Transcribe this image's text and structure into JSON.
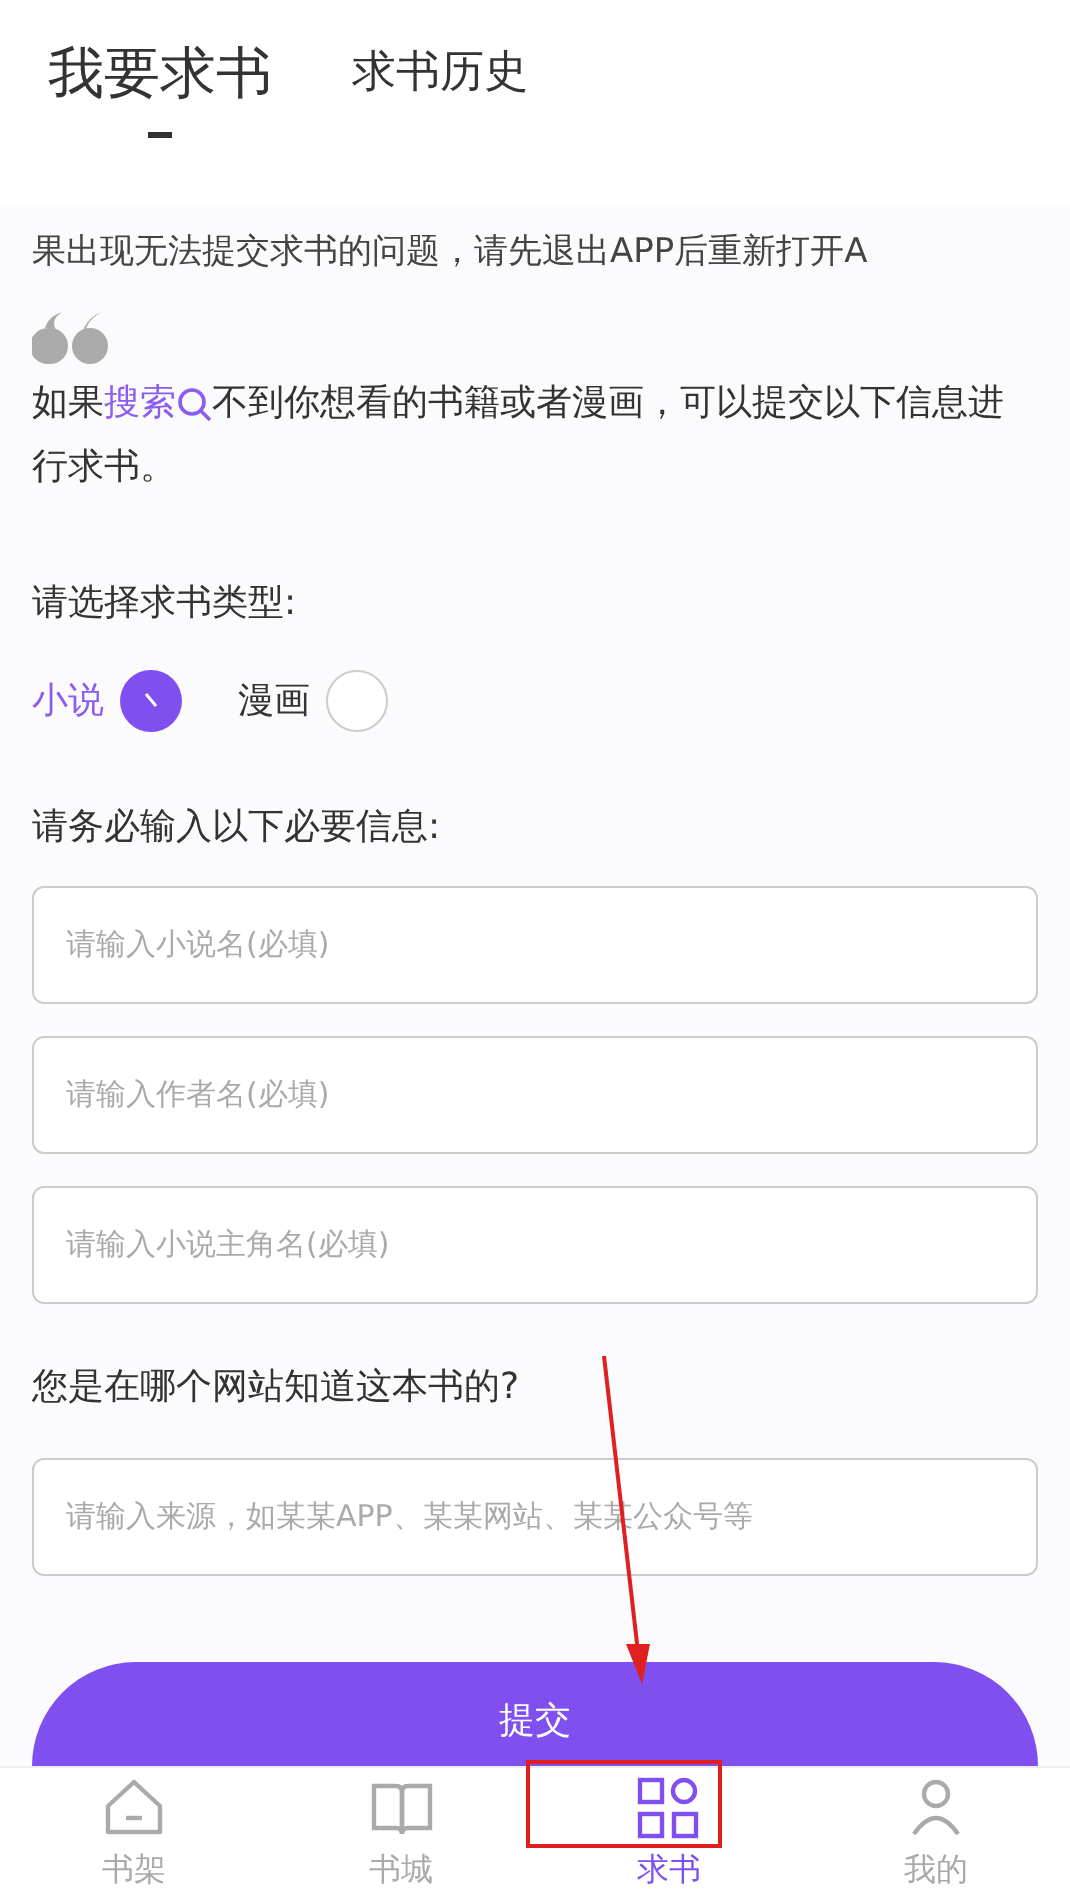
{
  "tabs": [
    {
      "label": "我要求书",
      "selected": true
    },
    {
      "label": "求书历史",
      "selected": false
    }
  ],
  "notice": "果出现无法提交求书的问题，请先退出APP后重新打开A",
  "intro": {
    "before": "如果",
    "link": "搜索",
    "after": "不到你想看的书籍或者漫画，可以提交以下信息进行求书。"
  },
  "type_label": "请选择求书类型:",
  "types": [
    {
      "label": "小说",
      "selected": true
    },
    {
      "label": "漫画",
      "selected": false
    }
  ],
  "required_label": "请务必输入以下必要信息:",
  "fields": [
    {
      "placeholder": "请输入小说名(必填)"
    },
    {
      "placeholder": "请输入作者名(必填)"
    },
    {
      "placeholder": "请输入小说主角名(必填)"
    }
  ],
  "source_label": "您是在哪个网站知道这本书的?",
  "source_field": {
    "placeholder": "请输入来源，如某某APP、某某网站、某某公众号等"
  },
  "submit": "提交",
  "nav": [
    {
      "label": "书架",
      "kind": "home",
      "selected": false
    },
    {
      "label": "书城",
      "kind": "book",
      "selected": false
    },
    {
      "label": "求书",
      "kind": "grid",
      "selected": true
    },
    {
      "label": "我的",
      "kind": "person",
      "selected": false
    }
  ]
}
